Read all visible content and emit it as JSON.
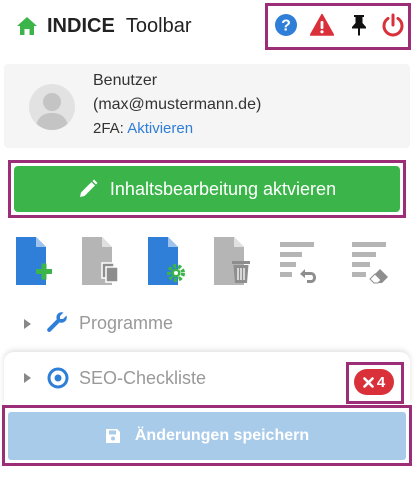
{
  "header": {
    "brand_bold": "INDICE",
    "brand_rest": "Toolbar",
    "icons": [
      "help-icon",
      "warning-icon",
      "pin-icon",
      "power-icon"
    ]
  },
  "user": {
    "name_label": "Benutzer",
    "email": "(max@mustermann.de)",
    "twofa_label": "2FA:",
    "twofa_link": "Aktivieren"
  },
  "edit_button": {
    "label": "Inhaltsbearbeitung aktvieren"
  },
  "tools": [
    "new-page-icon",
    "duplicate-page-icon",
    "page-settings-icon",
    "delete-page-icon",
    "revert-icon",
    "clear-icon"
  ],
  "sections": {
    "programme": {
      "label": "Programme"
    },
    "seo": {
      "label": "SEO-Checkliste",
      "badge_count": "4"
    }
  },
  "save_button": {
    "label": "Änderungen speichern"
  },
  "colors": {
    "brand": "#3bb54a",
    "highlight": "#9c2d77",
    "link": "#2f7ed8",
    "danger": "#d9303a",
    "help": "#2f7ed8",
    "save_disabled": "#a9cbea"
  }
}
